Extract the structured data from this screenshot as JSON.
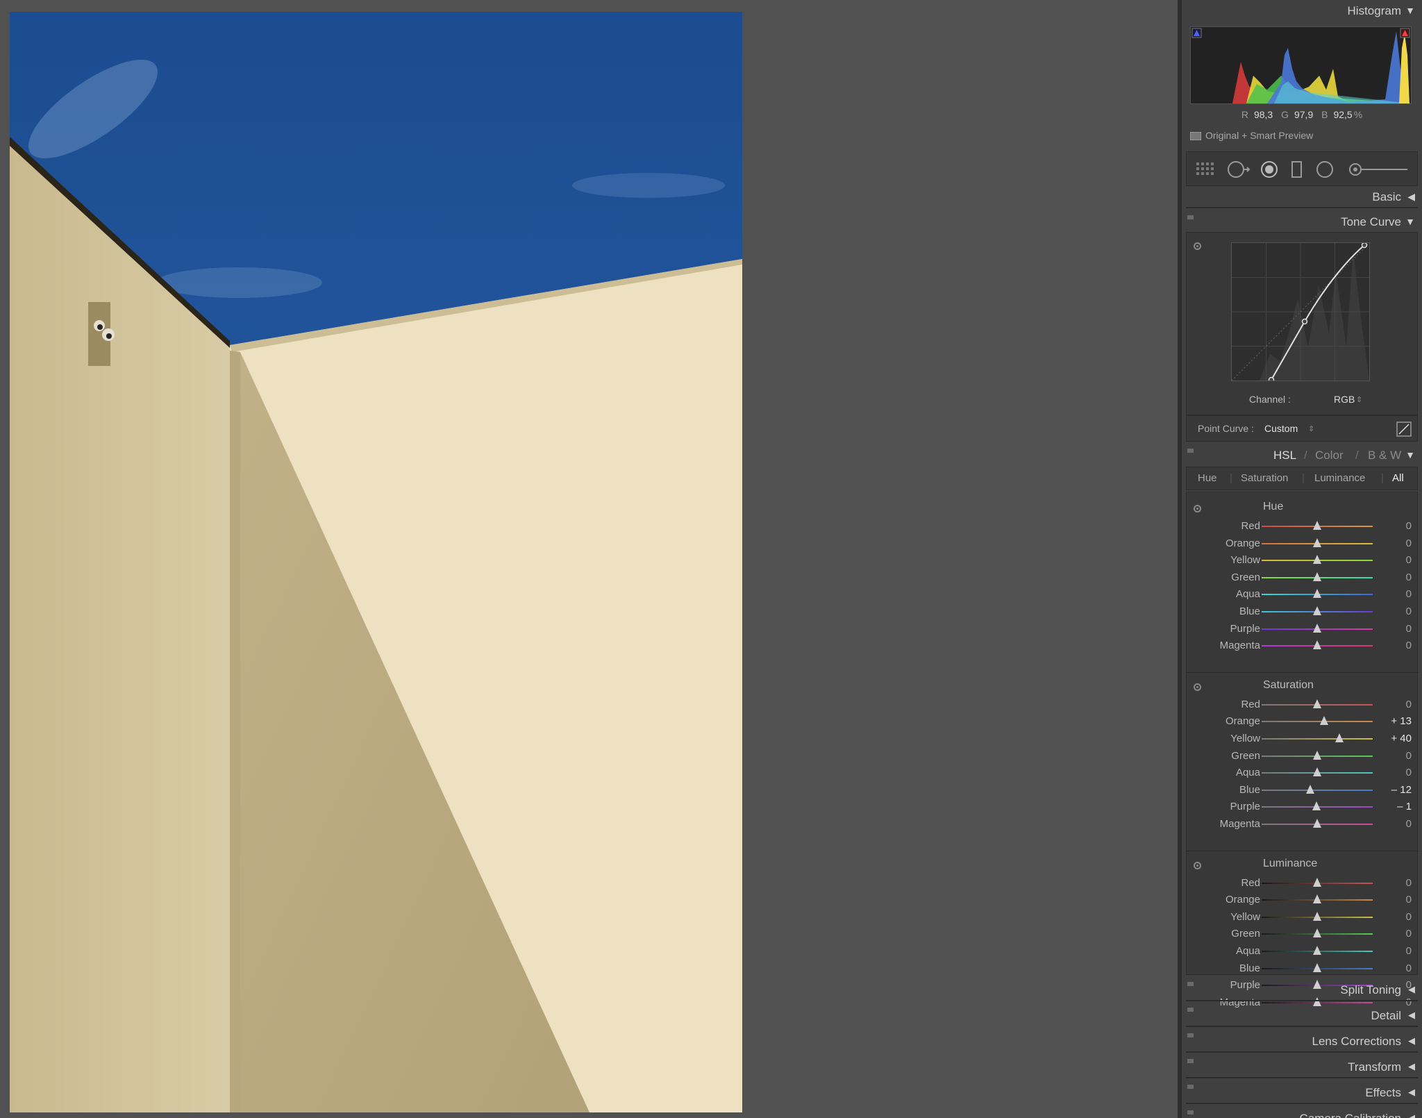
{
  "histogram": {
    "title": "Histogram",
    "readout": {
      "r_label": "R",
      "r": "98,3",
      "g_label": "G",
      "g": "97,9",
      "b_label": "B",
      "b": "92,5",
      "unit": "%"
    },
    "preview_label": "Original + Smart Preview"
  },
  "tools": [
    "grid-tool-icon",
    "crop-overlay-icon",
    "spot-removal-icon",
    "graduated-filter-icon",
    "radial-filter-icon",
    "adjustment-brush-icon"
  ],
  "basic": {
    "title": "Basic"
  },
  "tone_curve": {
    "title": "Tone Curve",
    "channel_label": "Channel :",
    "channel_value": "RGB",
    "point_curve_label": "Point Curve :",
    "point_curve_value": "Custom"
  },
  "hsl": {
    "title_hsl": "HSL",
    "title_color": "Color",
    "title_bw": "B & W",
    "sep": "/",
    "tabs": [
      "Hue",
      "Saturation",
      "Luminance",
      "All"
    ],
    "groups": [
      {
        "title": "Hue",
        "rows": [
          {
            "label": "Red",
            "value": "0",
            "pos": 0
          },
          {
            "label": "Orange",
            "value": "0",
            "pos": 0
          },
          {
            "label": "Yellow",
            "value": "0",
            "pos": 0
          },
          {
            "label": "Green",
            "value": "0",
            "pos": 0
          },
          {
            "label": "Aqua",
            "value": "0",
            "pos": 0
          },
          {
            "label": "Blue",
            "value": "0",
            "pos": 0
          },
          {
            "label": "Purple",
            "value": "0",
            "pos": 0
          },
          {
            "label": "Magenta",
            "value": "0",
            "pos": 0
          }
        ]
      },
      {
        "title": "Saturation",
        "rows": [
          {
            "label": "Red",
            "value": "0",
            "pos": 0
          },
          {
            "label": "Orange",
            "value": "+ 13",
            "pos": 13
          },
          {
            "label": "Yellow",
            "value": "+ 40",
            "pos": 40
          },
          {
            "label": "Green",
            "value": "0",
            "pos": 0
          },
          {
            "label": "Aqua",
            "value": "0",
            "pos": 0
          },
          {
            "label": "Blue",
            "value": "– 12",
            "pos": -12
          },
          {
            "label": "Purple",
            "value": "– 1",
            "pos": -1
          },
          {
            "label": "Magenta",
            "value": "0",
            "pos": 0
          }
        ]
      },
      {
        "title": "Luminance",
        "rows": [
          {
            "label": "Red",
            "value": "0",
            "pos": 0
          },
          {
            "label": "Orange",
            "value": "0",
            "pos": 0
          },
          {
            "label": "Yellow",
            "value": "0",
            "pos": 0
          },
          {
            "label": "Green",
            "value": "0",
            "pos": 0
          },
          {
            "label": "Aqua",
            "value": "0",
            "pos": 0
          },
          {
            "label": "Blue",
            "value": "0",
            "pos": 0
          },
          {
            "label": "Purple",
            "value": "0",
            "pos": 0
          },
          {
            "label": "Magenta",
            "value": "0",
            "pos": 0
          }
        ]
      }
    ]
  },
  "collapsed_panels": [
    "Split Toning",
    "Detail",
    "Lens Corrections",
    "Transform",
    "Effects",
    "Camera Calibration"
  ]
}
